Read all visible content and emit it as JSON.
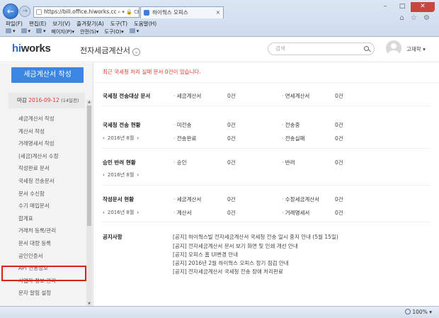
{
  "browser": {
    "address": "https://bill.office.hiworks.com/prime_grc",
    "address_host_bold": "hiworks",
    "address_tools": "⌕ ▾ 🔒 C",
    "tab_title": "하이웍스 오피스",
    "tab_close": "×",
    "menu": [
      "파일(F)",
      "편집(E)",
      "보기(V)",
      "즐겨찾기(A)",
      "도구(T)",
      "도움말(H)"
    ],
    "commands": [
      "▾",
      "▾",
      "▾",
      "페이지(P)▾",
      "안전(S)▾",
      "도구(O)▾",
      "▾"
    ],
    "window_controls": [
      "–",
      "□",
      "✕"
    ],
    "right_icons": "⌂ ☆ ⚙",
    "zoom": "100%",
    "zoom_arrow": "▾"
  },
  "header": {
    "logo_hi": "hi",
    "logo_rest": "works",
    "service_name": "전자세금계산서",
    "search_placeholder": "검색",
    "user_name": "고재학",
    "user_menu_arrow": "▾"
  },
  "sidebar": {
    "write_button": "세금계산서 작성",
    "deadline_label": "마감",
    "deadline_date": "2016-09-12",
    "deadline_days": "(14일전)",
    "items": [
      "세금계산서 작성",
      "계산서 작성",
      "거래명세서 작성",
      "(세금)계산서 수정",
      "작성완료 문서",
      "국세청 전송문서",
      "문서 수신함",
      "수기 매입문서",
      "합계표",
      "거래처 등록/관리",
      "문서 대량 등록",
      "공인인증서",
      "API 연동정보",
      "사업자 정보 관리",
      "문자 알림 설정"
    ],
    "scroll_up": "▲",
    "scroll_down": "▼"
  },
  "main": {
    "notice": "최근 국세청 처리 실패 문서 0건이 있습니다.",
    "sections": {
      "nts_target": {
        "title": "국세청 전송대상 문서",
        "items": [
          {
            "label": "세금계산서",
            "value": "0건"
          },
          {
            "label": "면세계산서",
            "value": "0건"
          }
        ]
      },
      "nts_status": {
        "title": "국세청 전송 현황",
        "date_prev": "‹",
        "date": "2016년 8월",
        "date_next": "›",
        "items": [
          {
            "label": "미전송",
            "value": "0건"
          },
          {
            "label": "전송중",
            "value": "0건"
          },
          {
            "label": "전송완료",
            "value": "0건"
          },
          {
            "label": "전송실패",
            "value": "0건"
          }
        ]
      },
      "approval": {
        "title": "승인 반려 현황",
        "date_prev": "‹",
        "date": "2016년 8월",
        "date_next": "›",
        "items": [
          {
            "label": "승인",
            "value": "0건"
          },
          {
            "label": "반려",
            "value": "0건"
          }
        ]
      },
      "written": {
        "title": "작성문서 현황",
        "date_prev": "‹",
        "date": "2016년 8월",
        "date_next": "›",
        "items": [
          {
            "label": "세금계산서",
            "value": "0건"
          },
          {
            "label": "수정세금계산서",
            "value": "0건"
          },
          {
            "label": "계산서",
            "value": "0건"
          },
          {
            "label": "거래명세서",
            "value": "0건"
          }
        ]
      }
    },
    "notices_title": "공지사항",
    "notices": [
      "[공지] 하이웍스빌 전자세금계산서 국세청 전송 일시 중지 안내 (5월 15일)",
      "[공지] 전자세금계산서 문서 보기 화면 및 인쇄 개선 안내",
      "[공지] 오피스 홈 UI변경 안내",
      "[공지] 2016년 2월 하이웍스 오피스 정기 점검 안내",
      "[공지] 전자세금계산서 국세청 전송 장애 처리완료"
    ]
  }
}
